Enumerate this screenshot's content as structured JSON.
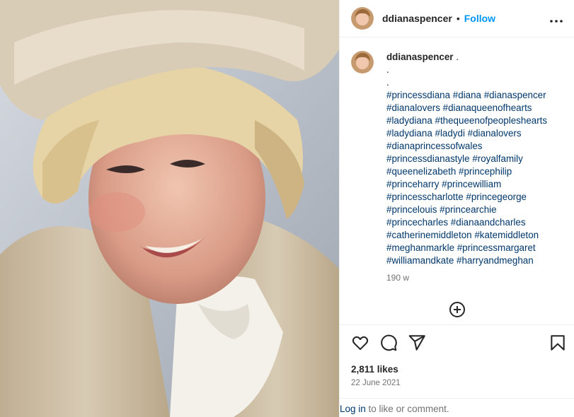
{
  "post": {
    "username": "ddianaspencer",
    "follow_label": "Follow",
    "separator": "•",
    "more_label": "•••"
  },
  "caption": {
    "username": "ddianaspencer",
    "text_first": ".",
    "line2": ".",
    "line3": ".",
    "hashtags": [
      "#princessdiana #diana #dianaspencer",
      "#dianalovers #dianaqueenofhearts",
      "#ladydiana #thequeenofpeopleshearts",
      "#ladydiana #ladydi #dianalovers",
      "#dianaprincessofwales",
      "#princessdianastyle #royalfamily",
      "#queenelizabeth #princephilip",
      "#princeharry #princewilliam",
      "#princesscharlotte #princegeorge",
      "#princelouis #princearchie",
      "#princecharles #dianaandcharles",
      "#catherinemiddleton #katemiddleton",
      "#meghanmarkle #princessmargaret",
      "#williamandkate #harryandmeghan"
    ],
    "time_ago": "190 w"
  },
  "engagement": {
    "likes": "2,811 likes",
    "date": "22 June 2021"
  },
  "login": {
    "link": "Log in",
    "rest": " to like or comment."
  },
  "icons": [
    "heart-icon",
    "comment-icon",
    "share-icon",
    "bookmark-icon",
    "add-comment-icon",
    "more-icon"
  ],
  "colors": {
    "accent": "#0095f6",
    "hashtag": "#00376b",
    "muted": "#737373"
  }
}
